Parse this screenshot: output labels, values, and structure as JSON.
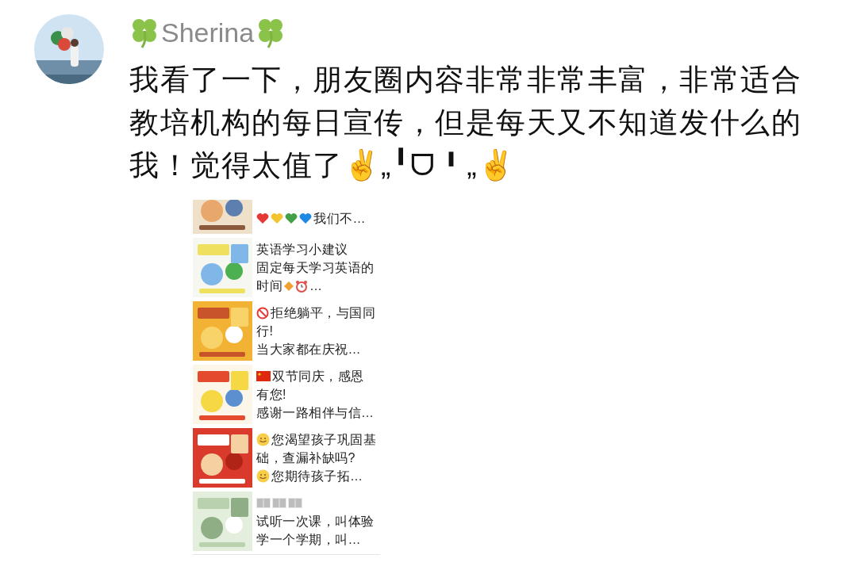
{
  "comment": {
    "author": "Sherina",
    "lines": [
      "我看了一下，朋友圈内容非常非常丰富，非常适合",
      "教培机构的每日宣传，但是每天又不知道发什么的",
      "我！觉得太值了✌„╹ᗜ╹„✌"
    ]
  },
  "posts": [
    {
      "kind": "picture",
      "lines": [
        [
          {
            "kind": "heart",
            "color": "#e53935"
          },
          {
            "kind": "heart",
            "color": "#f4c430"
          },
          {
            "kind": "heart",
            "color": "#43a047"
          },
          {
            "kind": "heart",
            "color": "#1e88e5"
          },
          {
            "kind": "text",
            "text": "我们不…"
          }
        ]
      ]
    },
    {
      "kind": "picture",
      "lines": [
        [
          {
            "kind": "text",
            "text": "英语学习小建议"
          }
        ],
        [
          {
            "kind": "text",
            "text": "固定每天学习英语的"
          }
        ],
        [
          {
            "kind": "text",
            "text": "时间"
          },
          {
            "kind": "diamond"
          },
          {
            "kind": "alarm"
          },
          {
            "kind": "text",
            "text": "…"
          }
        ]
      ]
    },
    {
      "kind": "picture",
      "lines": [
        [
          {
            "kind": "no-sign"
          },
          {
            "kind": "text",
            "text": "拒绝躺平，与国同"
          }
        ],
        [
          {
            "kind": "text",
            "text": "行!"
          }
        ],
        [
          {
            "kind": "text",
            "text": "当大家都在庆祝…"
          }
        ]
      ]
    },
    {
      "kind": "picture",
      "lines": [
        [
          {
            "kind": "flag"
          },
          {
            "kind": "text",
            "text": "双节同庆，感恩"
          }
        ],
        [
          {
            "kind": "text",
            "text": "有您!"
          }
        ],
        [
          {
            "kind": "text",
            "text": "感谢一路相伴与信…"
          }
        ]
      ]
    },
    {
      "kind": "picture",
      "lines": [
        [
          {
            "kind": "smiley"
          },
          {
            "kind": "text",
            "text": "您渴望孩子巩固基"
          }
        ],
        [
          {
            "kind": "text",
            "text": "础，查漏补缺吗?"
          }
        ],
        [
          {
            "kind": "smiley"
          },
          {
            "kind": "text",
            "text": "您期待孩子拓…"
          }
        ]
      ]
    },
    {
      "kind": "picture",
      "lines": [
        [
          {
            "kind": "book"
          },
          {
            "kind": "book"
          },
          {
            "kind": "book"
          }
        ],
        [
          {
            "kind": "text",
            "text": "试听一次课，叫体验"
          }
        ],
        [
          {
            "kind": "text",
            "text": "学一个学期，叫…"
          }
        ]
      ]
    }
  ]
}
